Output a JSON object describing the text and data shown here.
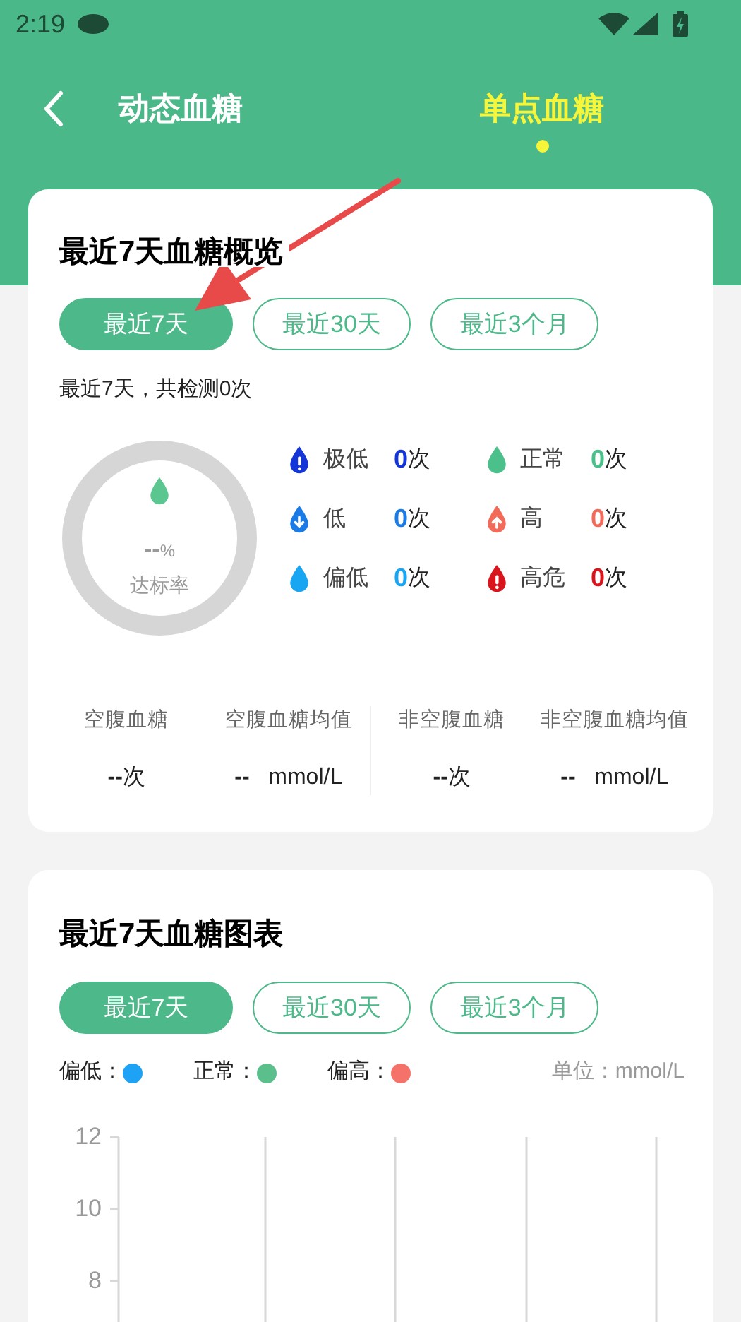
{
  "status_bar": {
    "time": "2:19"
  },
  "header": {
    "tabs": [
      {
        "label": "动态血糖",
        "selected": false
      },
      {
        "label": "单点血糖",
        "selected": true
      }
    ]
  },
  "overview": {
    "title": "最近7天血糖概览",
    "ranges": [
      {
        "label": "最近7天",
        "selected": true
      },
      {
        "label": "最近30天",
        "selected": false
      },
      {
        "label": "最近3个月",
        "selected": false
      }
    ],
    "summary": "最近7天，共检测0次",
    "ring": {
      "value": "--",
      "unit": "%",
      "label": "达标率"
    },
    "levels": [
      {
        "label": "极低",
        "count": "0",
        "unit": "次",
        "color": "#1436d9",
        "kind": "alert"
      },
      {
        "label": "正常",
        "count": "0",
        "unit": "次",
        "color": "#4cc08a",
        "kind": "plain"
      },
      {
        "label": "低",
        "count": "0",
        "unit": "次",
        "color": "#1a7ae6",
        "kind": "down"
      },
      {
        "label": "高",
        "count": "0",
        "unit": "次",
        "color": "#f26a5a",
        "kind": "up"
      },
      {
        "label": "偏低",
        "count": "0",
        "unit": "次",
        "color": "#18a6f2",
        "kind": "plain"
      },
      {
        "label": "高危",
        "count": "0",
        "unit": "次",
        "color": "#d8141c",
        "kind": "alert"
      }
    ],
    "stats": [
      {
        "label": "空腹血糖",
        "value": "--",
        "unit": "次"
      },
      {
        "label": "空腹血糖均值",
        "value": "--",
        "unit": "mmol/L"
      },
      {
        "label": "非空腹血糖",
        "value": "--",
        "unit": "次"
      },
      {
        "label": "非空腹血糖均值",
        "value": "--",
        "unit": "mmol/L"
      }
    ]
  },
  "chart_card": {
    "title": "最近7天血糖图表",
    "ranges": [
      {
        "label": "最近7天",
        "selected": true
      },
      {
        "label": "最近30天",
        "selected": false
      },
      {
        "label": "最近3个月",
        "selected": false
      }
    ],
    "legend": [
      {
        "label": "偏低：",
        "color": "#1ea2f5"
      },
      {
        "label": "正常：",
        "color": "#5bbf8c"
      },
      {
        "label": "偏高：",
        "color": "#f5726a"
      }
    ],
    "unit": "单位：mmol/L",
    "yticks": [
      "12",
      "10",
      "8"
    ]
  }
}
